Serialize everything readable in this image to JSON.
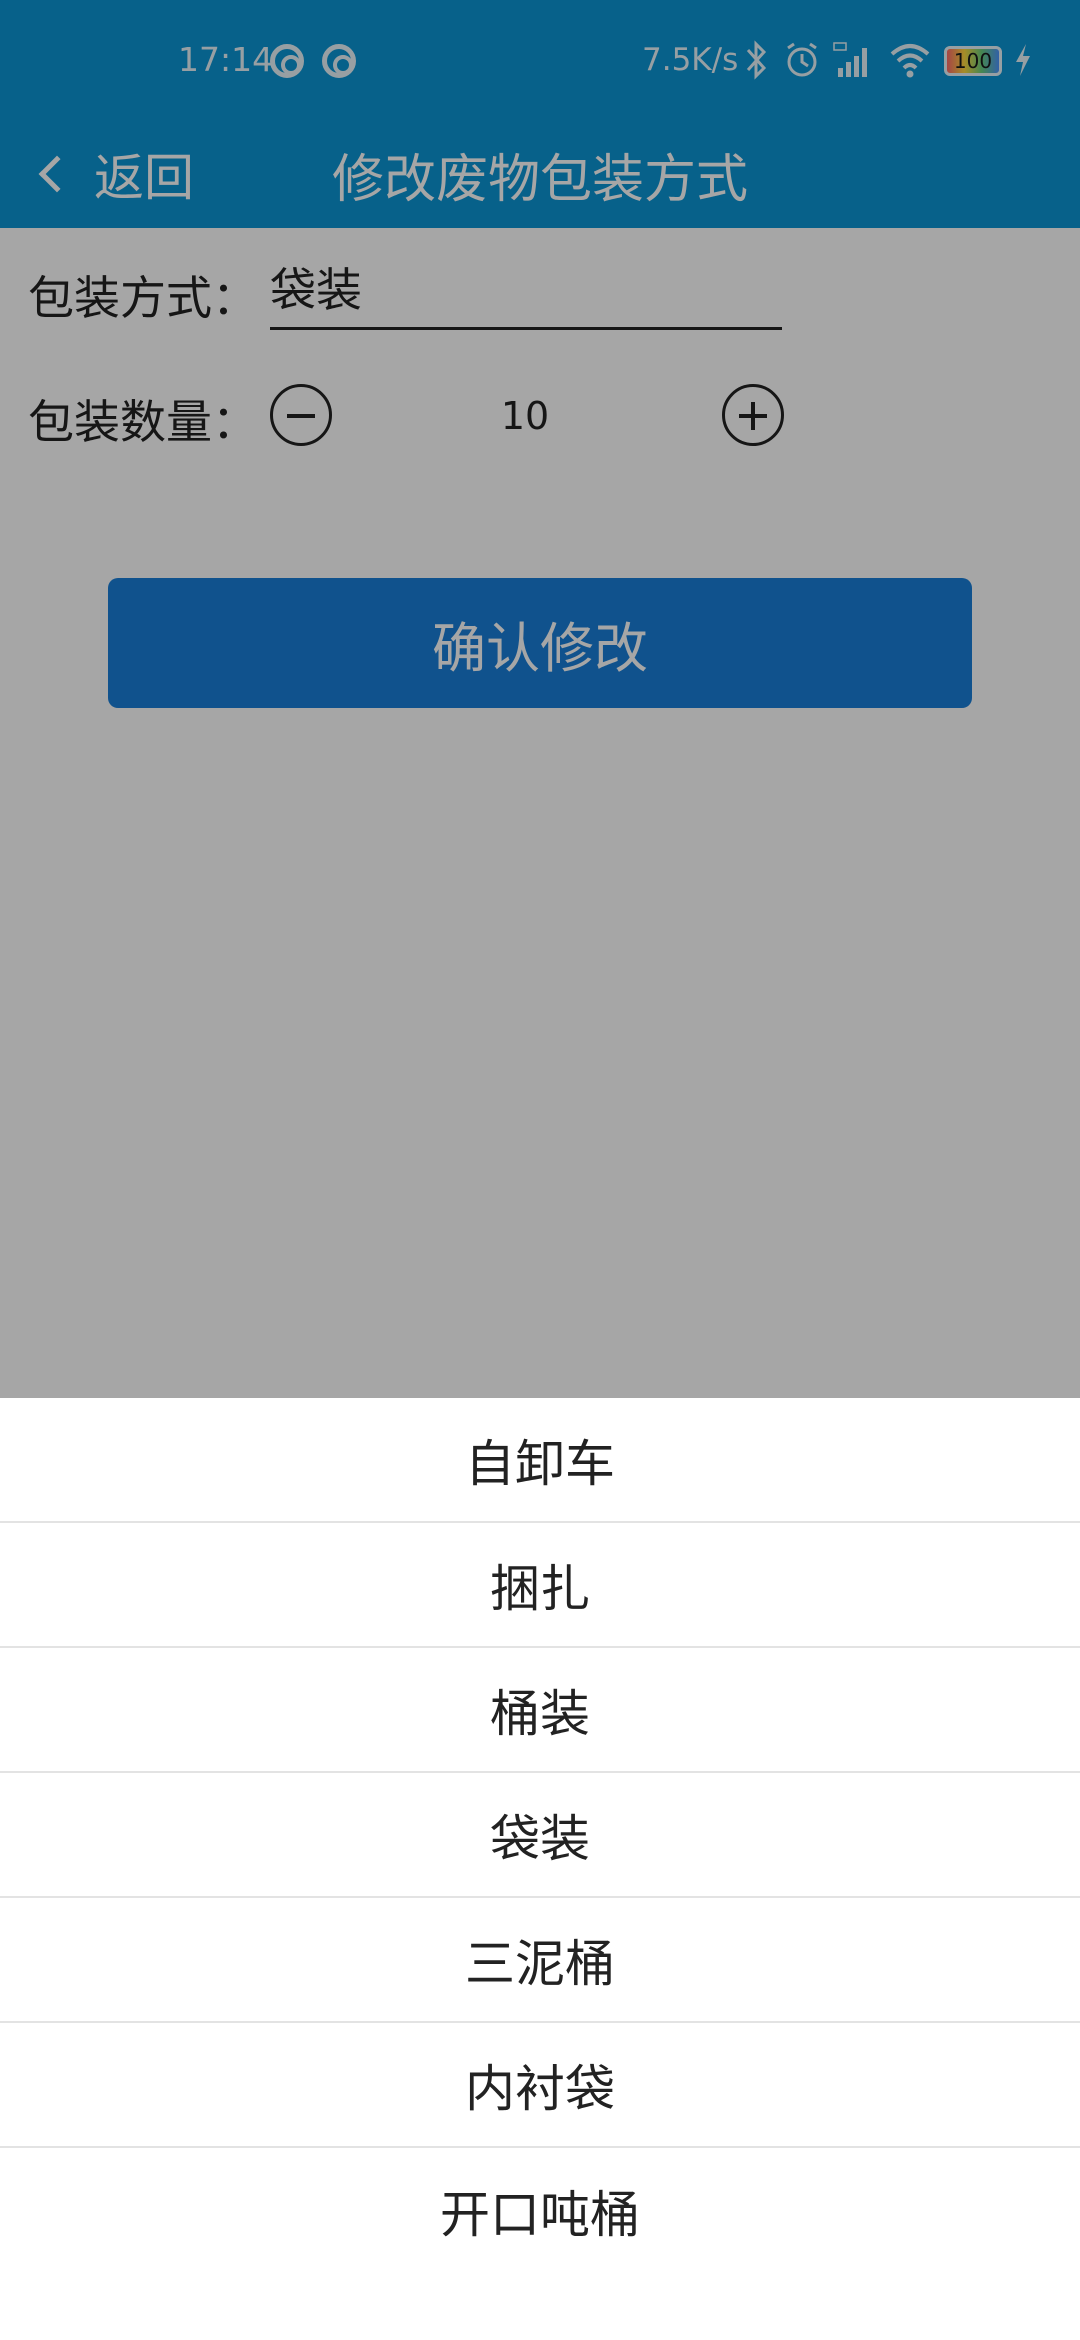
{
  "status_bar": {
    "time": "17:14",
    "net_speed": "7.5K/s",
    "battery": "100",
    "icons": [
      "app-notification-icon",
      "app-notification-icon",
      "bluetooth-icon",
      "alarm-icon",
      "signal-hd-icon",
      "wifi-icon",
      "battery-icon",
      "charging-icon"
    ]
  },
  "nav": {
    "back_label": "返回",
    "title": "修改废物包装方式"
  },
  "form": {
    "pack_type_label": "包装方式：",
    "pack_type_value": "袋装",
    "qty_label": "包装数量：",
    "qty_value": "10",
    "confirm_label": "确认修改"
  },
  "sheet": {
    "options": [
      "自卸车",
      "捆扎",
      "桶装",
      "袋装",
      "三泥桶",
      "内衬袋",
      "开口吨桶"
    ]
  },
  "colors": {
    "header_bg": "#0b95d4",
    "button_bg": "#1a7fd9",
    "overlay": "rgba(0,0,0,0.35)"
  }
}
